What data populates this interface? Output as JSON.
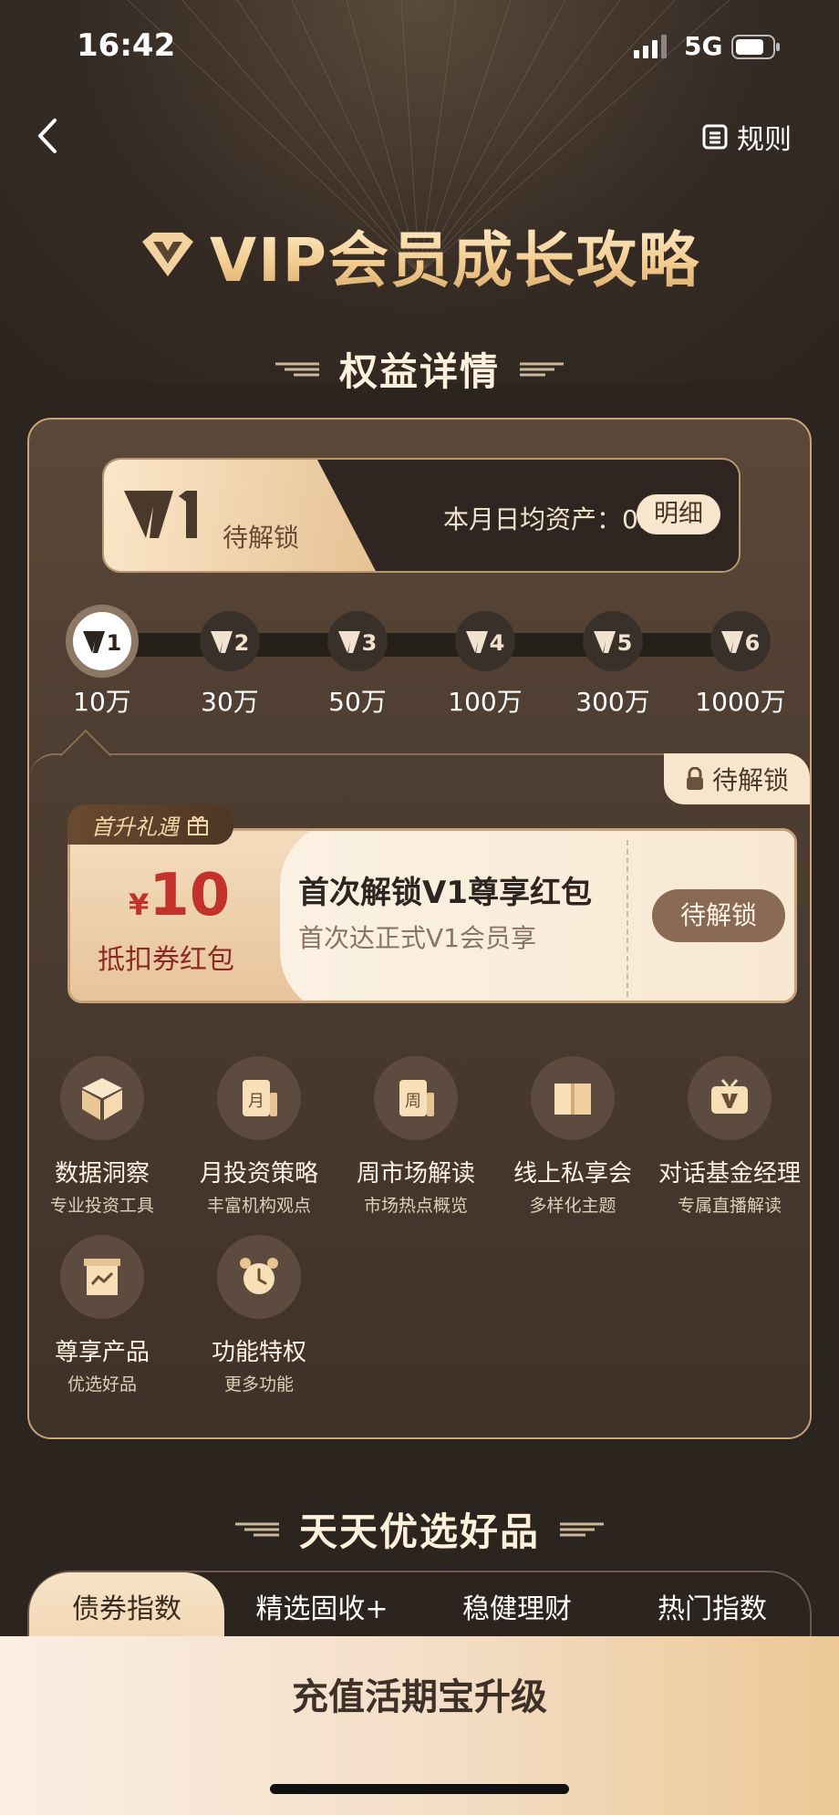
{
  "status_bar": {
    "time": "16:42",
    "network": "5G"
  },
  "nav": {
    "rules_label": "规则"
  },
  "hero": {
    "title": "VIP会员成长攻略"
  },
  "section_benefits": {
    "title": "权益详情"
  },
  "level_card": {
    "level": "V1",
    "status": "待解锁",
    "asset_text": "本月日均资产：0.00",
    "detail_button": "明细"
  },
  "levels": [
    {
      "label": "V1",
      "amount": "10万",
      "active": true
    },
    {
      "label": "V2",
      "amount": "30万",
      "active": false
    },
    {
      "label": "V3",
      "amount": "50万",
      "active": false
    },
    {
      "label": "V4",
      "amount": "100万",
      "active": false
    },
    {
      "label": "V5",
      "amount": "300万",
      "active": false
    },
    {
      "label": "V6",
      "amount": "1000万",
      "active": false
    }
  ],
  "benefit": {
    "lock_tag": "待解锁",
    "first_tag": "首升礼遇",
    "coupon": {
      "currency": "¥",
      "amount": "10",
      "type": "抵扣券红包",
      "title": "首次解锁V1尊享红包",
      "subtitle": "首次达正式V1会员享",
      "button": "待解锁"
    },
    "features": [
      {
        "name": "数据洞察",
        "desc": "专业投资工具",
        "icon": "cube-icon"
      },
      {
        "name": "月投资策略",
        "desc": "丰富机构观点",
        "icon": "monthly-calendar-icon"
      },
      {
        "name": "周市场解读",
        "desc": "市场热点概览",
        "icon": "weekly-calendar-icon"
      },
      {
        "name": "线上私享会",
        "desc": "多样化主题",
        "icon": "open-book-icon"
      },
      {
        "name": "对话基金经理",
        "desc": "专属直播解读",
        "icon": "tv-icon"
      },
      {
        "name": "尊享产品",
        "desc": "优选好品",
        "icon": "chart-box-icon"
      },
      {
        "name": "功能特权",
        "desc": "更多功能",
        "icon": "alarm-clock-icon"
      }
    ]
  },
  "section_products": {
    "title": "天天优选好品"
  },
  "tabs": [
    {
      "label": "债券指数",
      "active": true
    },
    {
      "label": "精选固收+",
      "active": false
    },
    {
      "label": "稳健理财",
      "active": false
    },
    {
      "label": "热门指数",
      "active": false
    }
  ],
  "bottom_cta": "充值活期宝升级",
  "colors": {
    "background": "#2c241f",
    "gold": "#f4cf93",
    "coupon_red": "#c2312a",
    "cta_gradient_end": "#ecc895"
  }
}
